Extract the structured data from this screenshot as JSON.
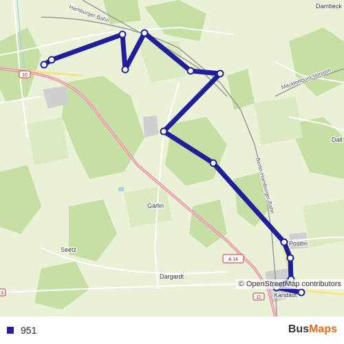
{
  "map": {
    "places": [
      {
        "name": "Dambeck"
      },
      {
        "name": "Garlin"
      },
      {
        "name": "Seetz"
      },
      {
        "name": "Dargardt"
      },
      {
        "name": "Dall"
      },
      {
        "name": "Karstädt"
      },
      {
        "name": "Postlin"
      }
    ],
    "rail_labels": {
      "hamburger_bahn": "Hamburger Bahn",
      "berlin_hamburg": "Berlin-Hamburger Bahn",
      "mecklenburg": "Mecklenburg-Vorpom"
    },
    "road_labels": {
      "a14": "A 14",
      "b10_west": "10",
      "b11_south": "11",
      "b3_edge": "3"
    },
    "attribution": "© OpenStreetMap contributors"
  },
  "route": {
    "name": "951",
    "color": "#1f1f99"
  },
  "legend": {
    "items": [
      {
        "label": "951",
        "color": "#1f1f99"
      }
    ]
  },
  "brand": {
    "part1": "Bus",
    "part2": "Maps",
    "color_main": "#333333",
    "color_accent": "#e26b1e"
  }
}
